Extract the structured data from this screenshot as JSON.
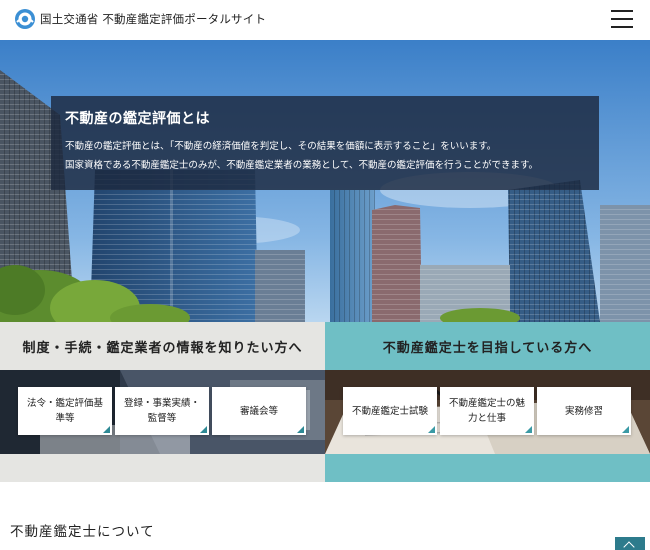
{
  "header": {
    "site_title": "国土交通省 不動産鑑定評価ポータルサイト",
    "logo_icon": "ministry-logo-icon",
    "menu_icon": "hamburger-menu-icon"
  },
  "intro": {
    "title": "不動産の鑑定評価とは",
    "line1": "不動産の鑑定評価とは、「不動産の経済価値を判定し、その結果を価額に表示すること」をいいます。",
    "line2": "国家資格である不動産鑑定士のみが、不動産鑑定業者の業務として、不動産の鑑定評価を行うことができます。"
  },
  "sections": {
    "left": {
      "heading": "制度・手続・鑑定業者の情報を知りたい方へ",
      "cards": [
        {
          "label": "法令・鑑定評価基準等"
        },
        {
          "label": "登録・事業実績・監督等"
        },
        {
          "label": "審議会等"
        }
      ]
    },
    "right": {
      "heading": "不動産鑑定士を目指している方へ",
      "cards": [
        {
          "label": "不動産鑑定士試験"
        },
        {
          "label": "不動産鑑定士の魅力と仕事"
        },
        {
          "label": "実務修習"
        }
      ]
    }
  },
  "about": {
    "title": "不動産鑑定士について"
  },
  "colors": {
    "teal_panel": "#6fbfc5",
    "grey_panel": "#e5e5e2",
    "intro_overlay": "#1c283e",
    "accent": "#2f8a95"
  }
}
